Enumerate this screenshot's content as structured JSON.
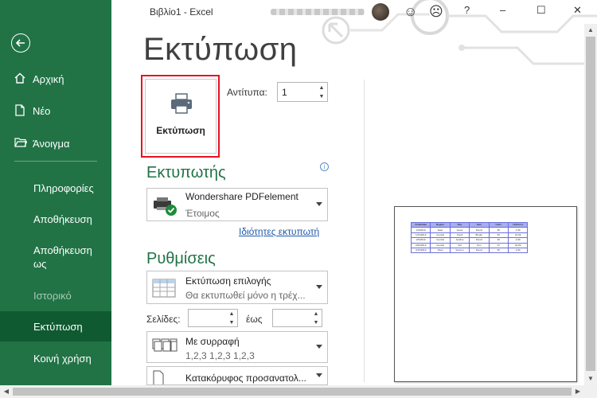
{
  "window": {
    "title": "Βιβλίο1  -  Excel",
    "minimize": "–",
    "maximize": "☐",
    "close": "✕",
    "help": "?",
    "smile": "☺",
    "frown": "☹"
  },
  "sidebar": {
    "items": [
      {
        "label": "Αρχική"
      },
      {
        "label": "Νέο"
      },
      {
        "label": "Άνοιγμα"
      }
    ],
    "text_items": [
      {
        "label": "Πληροφορίες"
      },
      {
        "label": "Αποθήκευση"
      },
      {
        "label": "Αποθήκευση"
      },
      {
        "label": "ως"
      },
      {
        "label": "Ιστορικό"
      },
      {
        "label": "Εκτύπωση"
      },
      {
        "label": "Κοινή χρήση"
      }
    ],
    "active": "Εκτύπωση"
  },
  "main": {
    "title": "Εκτύπωση",
    "print_button": "Εκτύπωση",
    "copies_label": "Αντίτυπα:",
    "copies_value": "1",
    "printer_section": "Εκτυπωτής",
    "printer_name": "Wondershare PDFelement",
    "printer_status": "Έτοιμος",
    "printer_properties": "Ιδιότητες εκτυπωτή",
    "settings_section": "Ρυθμίσεις",
    "print_what_main": "Εκτύπωση επιλογής",
    "print_what_sub": "Θα εκτυπωθεί μόνο η τρέχ...",
    "pages_label": "Σελίδες:",
    "to_label": "έως",
    "collate_main": "Με συρραφή",
    "collate_sub": "1,2,3    1,2,3    1,2,3",
    "orientation_main": "Κατακόρυφος προσανατολ..."
  },
  "preview": {
    "table": [
      [
        "OrderDate",
        "Region",
        "Rep",
        "Item",
        "Units",
        "UnitCost"
      ],
      [
        "1/6/2019",
        "East",
        "Jones",
        "Pencil",
        "95",
        "1.99"
      ],
      [
        "1/23/2019",
        "Central",
        "Kivell",
        "Binder",
        "50",
        "19.99"
      ],
      [
        "2/9/2019",
        "Central",
        "Jardine",
        "Pencil",
        "36",
        "4.99"
      ],
      [
        "2/26/2019",
        "Central",
        "Gill",
        "Pen",
        "27",
        "19.99"
      ],
      [
        "3/15/2019",
        "West",
        "Sorvino",
        "Pencil",
        "56",
        "2.99"
      ]
    ]
  },
  "colors": {
    "accent": "#217346",
    "active_nav": "#0f5a31",
    "highlight": "#e81123"
  }
}
